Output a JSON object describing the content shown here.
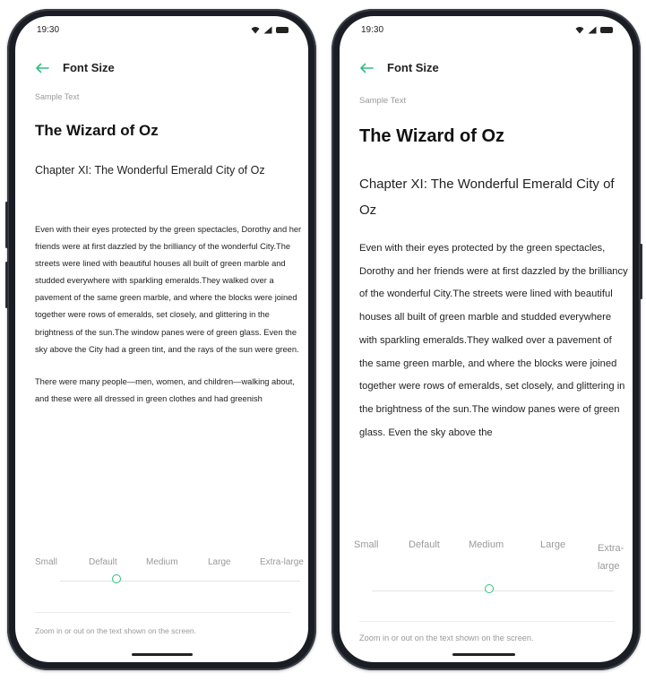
{
  "screens": [
    {
      "status_time": "19:30",
      "app_title": "Font Size",
      "sample_label": "Sample Text",
      "book_title": "The Wizard of Oz",
      "chapter_title": "Chapter XI: The Wonderful Emerald City of Oz",
      "paragraphs": [
        "Even with their eyes protected by the green spectacles, Dorothy and her friends were at first dazzled by the brilliancy of the wonderful City.The streets were lined with beautiful houses all built of green marble and studded everywhere with sparkling emeralds.They walked over a pavement of the same green marble, and where the blocks were joined together were rows of emeralds, set closely, and glittering in the brightness of the sun.The window panes were of green glass. Even the sky above the City had a green tint, and the rays of the sun were green.",
        "There were many people—men, women, and children—walking about, and these were all dressed in green clothes and had greenish"
      ],
      "size_options": [
        "Small",
        "Default",
        "Medium",
        "Large",
        "Extra-large"
      ],
      "selected_size": "Default",
      "zoom_hint": "Zoom in or out on the text shown on the screen."
    },
    {
      "status_time": "19:30",
      "app_title": "Font Size",
      "sample_label": "Sample Text",
      "book_title": "The Wizard of Oz",
      "chapter_title": "Chapter XI: The Wonderful Emerald City of Oz",
      "paragraphs": [
        "Even with their eyes protected by the green spectacles, Dorothy and her friends were at first dazzled by the brilliancy of the wonderful City.The streets were lined with beautiful houses all built of green marble and studded everywhere with sparkling emeralds.They walked over a pavement of the same green marble, and where the blocks were joined together were rows of emeralds, set closely, and glittering in the brightness of the sun.The window panes were of green glass. Even the sky above the"
      ],
      "size_options": [
        "Small",
        "Default",
        "Medium",
        "Large",
        "Extra-large"
      ],
      "selected_size": "Medium",
      "zoom_hint": "Zoom in or out on the text shown on the screen."
    }
  ],
  "colors": {
    "accent": "#2fbf80",
    "muted_text": "#9a9a9a",
    "frame": "#1b1d24"
  },
  "icons": {
    "back": "back-arrow-icon",
    "wifi": "wifi-icon",
    "signal": "signal-icon",
    "battery": "battery-icon"
  }
}
